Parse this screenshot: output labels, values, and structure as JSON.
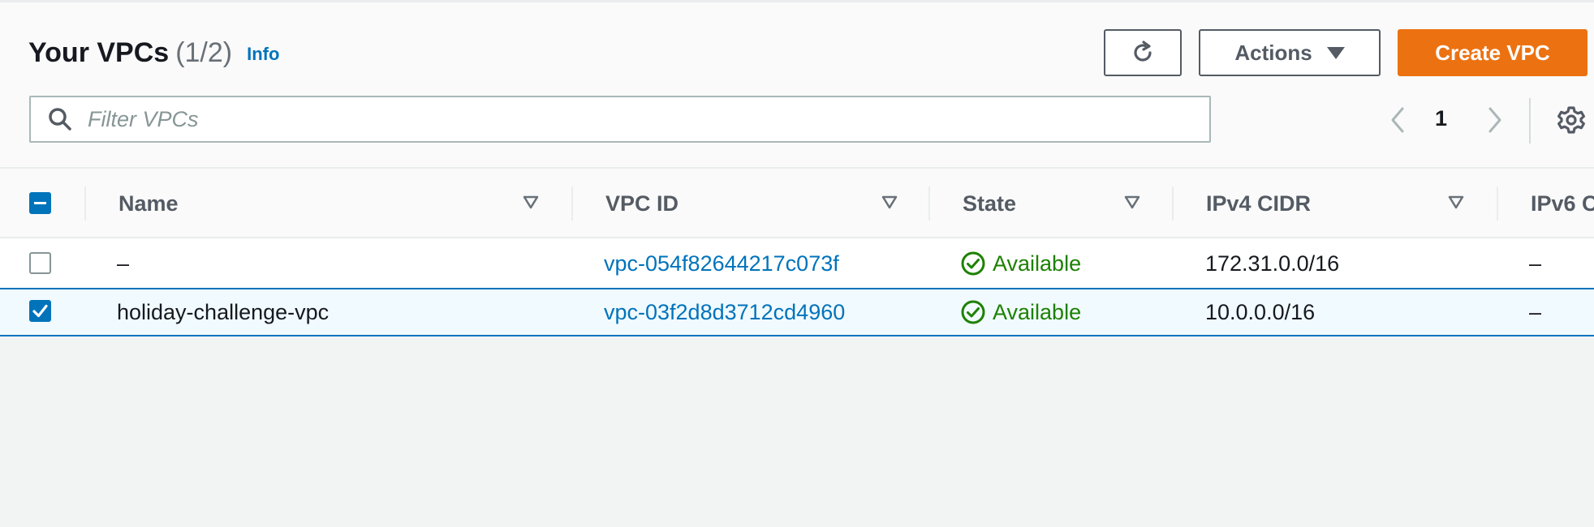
{
  "header": {
    "title": "Your VPCs",
    "count": "(1/2)",
    "info_label": "Info",
    "actions_label": "Actions",
    "create_label": "Create VPC"
  },
  "search": {
    "placeholder": "Filter VPCs"
  },
  "pagination": {
    "current_page": "1"
  },
  "columns": [
    "Name",
    "VPC ID",
    "State",
    "IPv4 CIDR",
    "IPv6 C"
  ],
  "rows": [
    {
      "name": "–",
      "vpc_id": "vpc-054f82644217c073f",
      "state": "Available",
      "ipv4_cidr": "172.31.0.0/16",
      "ipv6": "–",
      "selected": false
    },
    {
      "name": "holiday-challenge-vpc",
      "vpc_id": "vpc-03f2d8d3712cd4960",
      "state": "Available",
      "ipv4_cidr": "10.0.0.0/16",
      "ipv6": "–",
      "selected": true
    }
  ],
  "colors": {
    "accent": "#0073bb",
    "primary_button": "#ec7211",
    "status_ok": "#1d8102"
  },
  "icons": [
    "refresh-icon",
    "caret-down-icon",
    "search-icon",
    "chevron-left-icon",
    "chevron-right-icon",
    "settings-gear-icon",
    "sort-icon",
    "status-available-icon"
  ]
}
